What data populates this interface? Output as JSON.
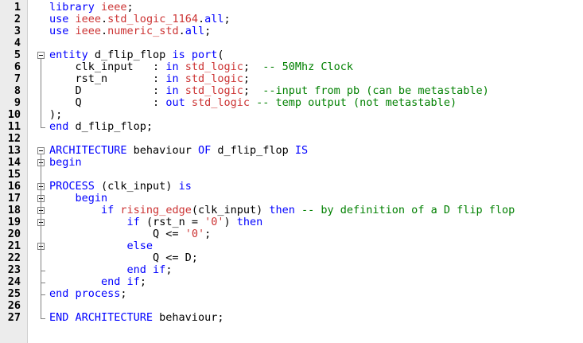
{
  "editor": {
    "lines": [
      {
        "n": "1",
        "segs": [
          [
            "kw",
            "library "
          ],
          [
            "lib",
            "ieee"
          ],
          [
            "",
            "; "
          ]
        ]
      },
      {
        "n": "2",
        "segs": [
          [
            "kw",
            "use "
          ],
          [
            "lib",
            "ieee"
          ],
          [
            "",
            ".",
            ""
          ],
          [
            "lib",
            "std_logic_1164"
          ],
          [
            "",
            "."
          ],
          [
            "kw",
            "all"
          ],
          [
            "",
            ";"
          ]
        ]
      },
      {
        "n": "3",
        "segs": [
          [
            "kw",
            "use "
          ],
          [
            "lib",
            "ieee"
          ],
          [
            "",
            "."
          ],
          [
            "lib",
            "numeric_std"
          ],
          [
            "",
            "."
          ],
          [
            "kw",
            "all"
          ],
          [
            "",
            ";"
          ]
        ]
      },
      {
        "n": "4",
        "segs": []
      },
      {
        "n": "5",
        "segs": [
          [
            "kw",
            "entity "
          ],
          [
            "",
            "d_flip_flop "
          ],
          [
            "kw",
            "is port"
          ],
          [
            "",
            "("
          ]
        ]
      },
      {
        "n": "6",
        "segs": [
          [
            "",
            "    clk_input   : "
          ],
          [
            "kw",
            "in "
          ],
          [
            "ty",
            "std_logic"
          ],
          [
            "",
            ";  "
          ],
          [
            "cm",
            "-- 50Mhz Clock"
          ]
        ]
      },
      {
        "n": "7",
        "segs": [
          [
            "",
            "    rst_n       : "
          ],
          [
            "kw",
            "in "
          ],
          [
            "ty",
            "std_logic"
          ],
          [
            "",
            ";"
          ]
        ]
      },
      {
        "n": "8",
        "segs": [
          [
            "",
            "    D           : "
          ],
          [
            "kw",
            "in "
          ],
          [
            "ty",
            "std_logic"
          ],
          [
            "",
            ";  "
          ],
          [
            "cm",
            "--input from pb (can be metastable)"
          ]
        ]
      },
      {
        "n": "9",
        "segs": [
          [
            "",
            "    Q           : "
          ],
          [
            "kw",
            "out "
          ],
          [
            "ty",
            "std_logic"
          ],
          [
            "cm",
            " -- temp output (not metastable)"
          ]
        ]
      },
      {
        "n": "10",
        "segs": [
          [
            "",
            ");"
          ]
        ]
      },
      {
        "n": "11",
        "segs": [
          [
            "kw",
            "end "
          ],
          [
            "",
            "d_flip_flop;"
          ]
        ]
      },
      {
        "n": "12",
        "segs": []
      },
      {
        "n": "13",
        "segs": [
          [
            "kw",
            "ARCHITECTURE "
          ],
          [
            "",
            "behaviour "
          ],
          [
            "kw",
            "OF "
          ],
          [
            "",
            "d_flip_flop "
          ],
          [
            "kw",
            "IS"
          ]
        ]
      },
      {
        "n": "14",
        "segs": [
          [
            "kw",
            "begin"
          ]
        ]
      },
      {
        "n": "15",
        "segs": []
      },
      {
        "n": "16",
        "segs": [
          [
            "kw",
            "PROCESS "
          ],
          [
            "",
            "(clk_input) "
          ],
          [
            "kw",
            "is"
          ]
        ]
      },
      {
        "n": "17",
        "segs": [
          [
            "",
            "    "
          ],
          [
            "kw",
            "begin"
          ]
        ]
      },
      {
        "n": "18",
        "segs": [
          [
            "",
            "        "
          ],
          [
            "kw",
            "if "
          ],
          [
            "fn",
            "rising_edge"
          ],
          [
            "",
            "(clk_input) "
          ],
          [
            "kw",
            "then "
          ],
          [
            "cm",
            "-- by definition of a D flip flop"
          ]
        ]
      },
      {
        "n": "19",
        "segs": [
          [
            "",
            "            "
          ],
          [
            "kw",
            "if "
          ],
          [
            "",
            "(rst_n = "
          ],
          [
            "str",
            "'0'"
          ],
          [
            "",
            ") "
          ],
          [
            "kw",
            "then"
          ]
        ]
      },
      {
        "n": "20",
        "segs": [
          [
            "",
            "                Q <= "
          ],
          [
            "str",
            "'0'"
          ],
          [
            "",
            ";"
          ]
        ]
      },
      {
        "n": "21",
        "segs": [
          [
            "",
            "            "
          ],
          [
            "kw",
            "else"
          ]
        ]
      },
      {
        "n": "22",
        "segs": [
          [
            "",
            "                Q <= D;"
          ]
        ]
      },
      {
        "n": "23",
        "segs": [
          [
            "",
            "            "
          ],
          [
            "kw",
            "end if"
          ],
          [
            "",
            ";"
          ]
        ]
      },
      {
        "n": "24",
        "segs": [
          [
            "",
            "        "
          ],
          [
            "kw",
            "end if"
          ],
          [
            "",
            ";"
          ]
        ]
      },
      {
        "n": "25",
        "segs": [
          [
            "kw",
            "end process"
          ],
          [
            "",
            ";"
          ]
        ]
      },
      {
        "n": "26",
        "segs": []
      },
      {
        "n": "27",
        "segs": [
          [
            "kw",
            "END ARCHITECTURE "
          ],
          [
            "",
            "behaviour;"
          ]
        ]
      }
    ],
    "fold_markers": [
      5,
      13,
      14,
      16,
      17,
      18,
      19,
      21
    ]
  }
}
